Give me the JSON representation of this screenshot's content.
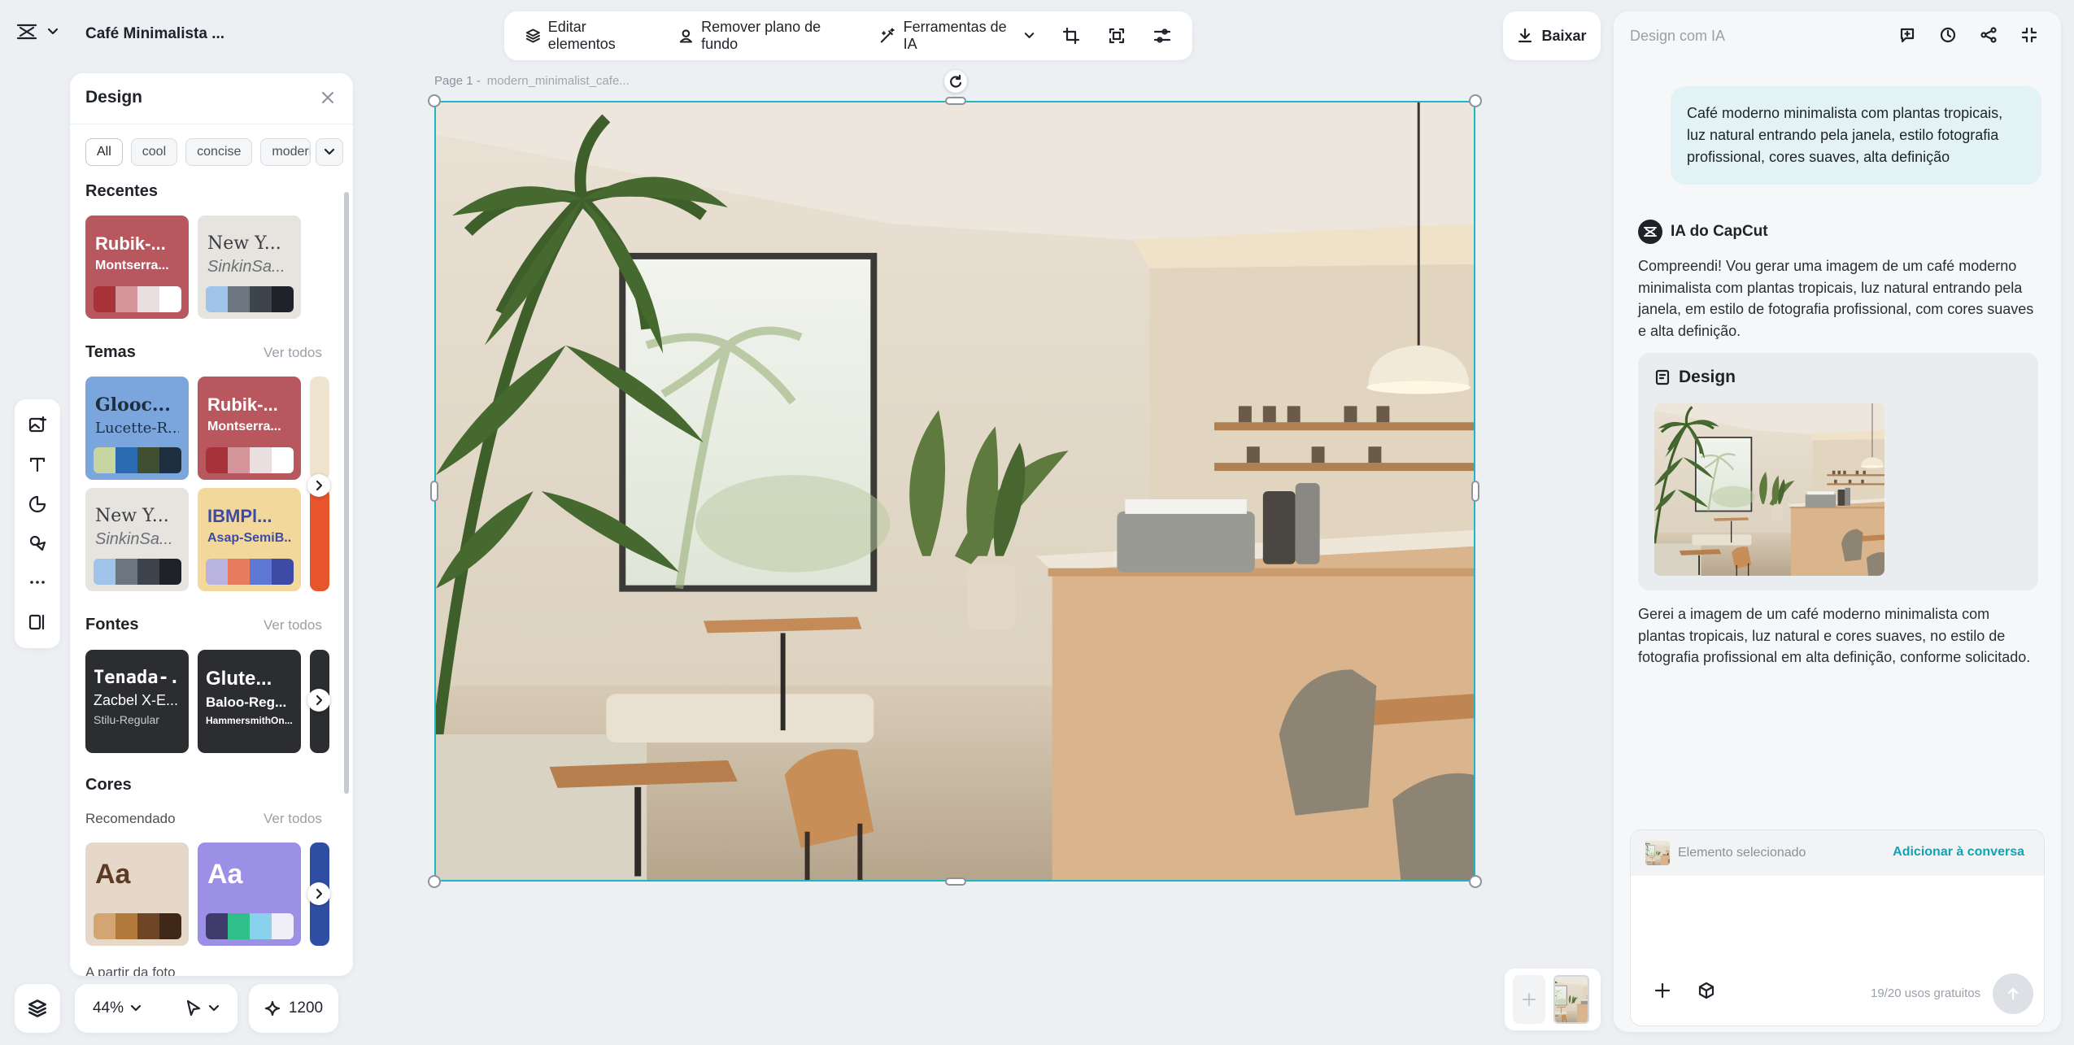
{
  "header": {
    "doc_title": "Café Minimalista ...",
    "toolbar": {
      "edit_elements": "Editar elementos",
      "remove_bg": "Remover plano de fundo",
      "ai_tools": "Ferramentas de IA"
    },
    "download": "Baixar"
  },
  "design_panel": {
    "title": "Design",
    "filters": [
      "All",
      "cool",
      "concise",
      "modern"
    ],
    "recent_title": "Recentes",
    "recent": [
      {
        "font1": "Rubik-...",
        "font2": "Montserra...",
        "bg": "#b9575f",
        "colors": [
          "#a8323a",
          "#d4959a",
          "#e9dfe0",
          "#ffffff"
        ]
      },
      {
        "font1": "New Y...",
        "font2": "SinkinSa...",
        "bg": "#e7e3de",
        "colors": [
          "#9fc3e9",
          "#6b7680",
          "#3d444c",
          "#1f2329"
        ]
      }
    ],
    "themes_title": "Temas",
    "see_all": "Ver todos",
    "themes": [
      {
        "font1": "Glooc...",
        "font2": "Lucette-R...",
        "bg": "#7aa5dd",
        "colors": [
          "#c9d5a0",
          "#2a6ab0",
          "#3f4f30",
          "#1d2f3f"
        ]
      },
      {
        "font1": "Rubik-...",
        "font2": "Montserra...",
        "bg": "#b9575f",
        "colors": [
          "#a8323a",
          "#d4959a",
          "#e9dfe0",
          "#ffffff"
        ]
      },
      {
        "font1": "New Y...",
        "font2": "SinkinSa...",
        "bg": "#e7e3de",
        "colors": [
          "#9fc3e9",
          "#6b7680",
          "#3d444c",
          "#1f2329"
        ]
      },
      {
        "font1": "IBMPl...",
        "font2": "Asap-SemiB...",
        "bg": "#f3d89b",
        "colors": [
          "#b9b3e0",
          "#e87c5e",
          "#5f78d6",
          "#3d4aa6"
        ]
      }
    ],
    "fonts_title": "Fontes",
    "fonts": [
      {
        "line1": "Tenada-...",
        "line2": "Zacbel X-E...",
        "line3": "Stilu-Regular"
      },
      {
        "line1": "Glute...",
        "line2": "Baloo-Reg...",
        "line3": "HammersmithOn..."
      }
    ],
    "colors_title": "Cores",
    "recommended": "Recomendado",
    "color_cards": [
      {
        "text": "Aa",
        "bg": "#e5d8c8",
        "fg": "#5b3b24",
        "colors": [
          "#d2a572",
          "#b27a3a",
          "#6e4525",
          "#3f2817"
        ]
      },
      {
        "text": "Aa",
        "bg": "#9b8fe6",
        "fg": "#ffffff",
        "colors": [
          "#3f3b6b",
          "#2fbf8a",
          "#8ad1ee",
          "#f0eef7"
        ]
      }
    ],
    "from_photo": "A partir da foto"
  },
  "bottom_bar": {
    "zoom": "44%",
    "credits": "1200"
  },
  "canvas": {
    "page_label": "Page 1 -",
    "page_name": "modern_minimalist_cafe..."
  },
  "right_panel": {
    "title": "Design com IA",
    "user_message": "Café moderno minimalista com plantas tropicais, luz natural entrando pela janela, estilo fotografia profissional, cores suaves, alta definição",
    "ai_name": "IA do CapCut",
    "ai_reply_1": "Compreendi! Vou gerar uma imagem de um café moderno minimalista com plantas tropicais, luz natural entrando pela janela, em estilo de fotografia profissional, com cores suaves e alta definição.",
    "result_title": "Design",
    "ai_reply_2": "Gerei a imagem de um café moderno minimalista com plantas tropicais, luz natural e cores suaves, no estilo de fotografia profissional em alta definição, conforme solicitado.",
    "selected_element": "Elemento selecionado",
    "add_to_conversation": "Adicionar à conversa",
    "usage": "19/20 usos gratuitos"
  }
}
